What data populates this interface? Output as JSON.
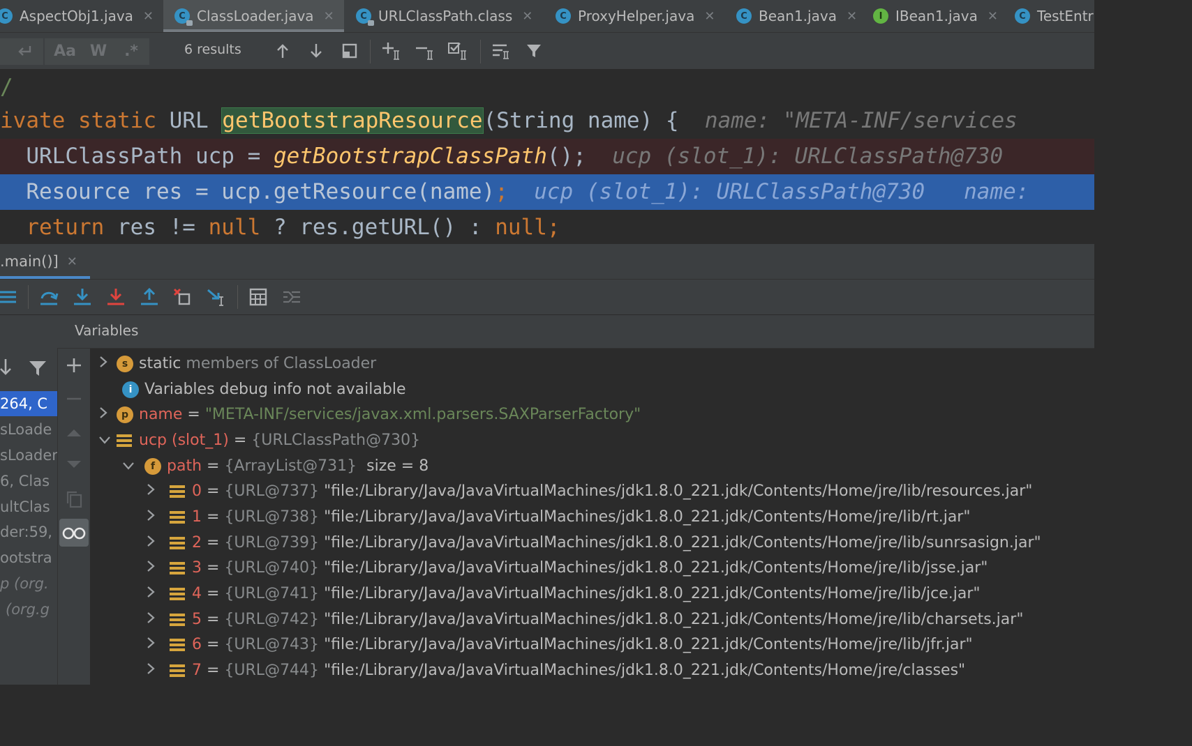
{
  "tabs": [
    {
      "label": "AspectObj1.java",
      "icon": "class-icon",
      "active": false
    },
    {
      "label": "ClassLoader.java",
      "icon": "class-locked-icon",
      "active": true
    },
    {
      "label": "URLClassPath.class",
      "icon": "class-locked-icon",
      "active": false
    },
    {
      "label": "ProxyHelper.java",
      "icon": "class-icon",
      "active": false
    },
    {
      "label": "Bean1.java",
      "icon": "class-icon",
      "active": false
    },
    {
      "label": "IBean1.java",
      "icon": "interface-icon",
      "active": false
    },
    {
      "label": "TestEntr",
      "icon": "test-class-icon",
      "active": false
    }
  ],
  "tab_icon_letters": {
    "class": "C",
    "interface": "I"
  },
  "search": {
    "option_case": "Aa",
    "option_word": "W",
    "option_regex": ".*",
    "results": "6 results"
  },
  "code": {
    "line0": "/",
    "line1_kw1": "ivate",
    "line1_kw2": "static",
    "line1_type": "URL",
    "line1_method": "getBootstrapResource",
    "line1_params": "(String name) {",
    "line1_hint": "name: \"META-INF/services",
    "line2_code": "URLClassPath ucp = ",
    "line2_call": "getBootstrapClassPath",
    "line2_end": "();",
    "line2_hint": "ucp (slot_1): URLClassPath@730",
    "line3_code": "Resource res = ucp.getResource(name)",
    "line3_end": ";",
    "line3_hint": "ucp (slot_1): URLClassPath@730   name:",
    "line4_kw": "return",
    "line4_mid": " res != ",
    "line4_null1": "null",
    "line4_mid2": " ? res.getURL() : ",
    "line4_null2": "null",
    "line4_end": ";"
  },
  "debug": {
    "session_tab": ".main()]",
    "variables_title": "Variables"
  },
  "frames": [
    "264, C",
    "sLoade",
    "sLoader",
    "6, Clas",
    "ultClas",
    "der:59,",
    "ootstra",
    "p (org.",
    "(org.g"
  ],
  "variables": {
    "static_label": "static",
    "static_rest": " members of ClassLoader",
    "info": "Variables debug info not available",
    "name_var": "name",
    "name_value": "\"META-INF/services/javax.xml.parsers.SAXParserFactory\"",
    "ucp_var": "ucp (slot_1)",
    "ucp_value": "{URLClassPath@730}",
    "path_var": "path",
    "path_value": "{ArrayList@731}",
    "path_size": "size = 8",
    "items": [
      {
        "index": "0",
        "ref": "{URL@737}",
        "value": "\"file:/Library/Java/JavaVirtualMachines/jdk1.8.0_221.jdk/Contents/Home/jre/lib/resources.jar\""
      },
      {
        "index": "1",
        "ref": "{URL@738}",
        "value": "\"file:/Library/Java/JavaVirtualMachines/jdk1.8.0_221.jdk/Contents/Home/jre/lib/rt.jar\""
      },
      {
        "index": "2",
        "ref": "{URL@739}",
        "value": "\"file:/Library/Java/JavaVirtualMachines/jdk1.8.0_221.jdk/Contents/Home/jre/lib/sunrsasign.jar\""
      },
      {
        "index": "3",
        "ref": "{URL@740}",
        "value": "\"file:/Library/Java/JavaVirtualMachines/jdk1.8.0_221.jdk/Contents/Home/jre/lib/jsse.jar\""
      },
      {
        "index": "4",
        "ref": "{URL@741}",
        "value": "\"file:/Library/Java/JavaVirtualMachines/jdk1.8.0_221.jdk/Contents/Home/jre/lib/jce.jar\""
      },
      {
        "index": "5",
        "ref": "{URL@742}",
        "value": "\"file:/Library/Java/JavaVirtualMachines/jdk1.8.0_221.jdk/Contents/Home/jre/lib/charsets.jar\""
      },
      {
        "index": "6",
        "ref": "{URL@743}",
        "value": "\"file:/Library/Java/JavaVirtualMachines/jdk1.8.0_221.jdk/Contents/Home/jre/lib/jfr.jar\""
      },
      {
        "index": "7",
        "ref": "{URL@744}",
        "value": "\"file:/Library/Java/JavaVirtualMachines/jdk1.8.0_221.jdk/Contents/Home/jre/classes\""
      }
    ]
  },
  "colors": {
    "keyword": "#cc7832",
    "method": "#ffc66d",
    "string": "#6a8759",
    "selection": "#2d5fa8",
    "accent": "#4a88c7"
  }
}
